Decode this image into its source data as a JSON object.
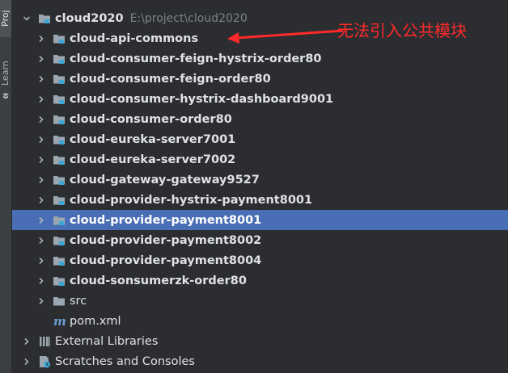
{
  "tool_strip": {
    "project_tab": "Proj",
    "learn_tab": "Learn"
  },
  "root": {
    "name": "cloud2020",
    "path": "E:\\project\\cloud2020"
  },
  "modules": [
    {
      "label": "cloud-api-commons"
    },
    {
      "label": "cloud-consumer-feign-hystrix-order80"
    },
    {
      "label": "cloud-consumer-feign-order80"
    },
    {
      "label": "cloud-consumer-hystrix-dashboard9001"
    },
    {
      "label": "cloud-consumer-order80"
    },
    {
      "label": "cloud-eureka-server7001"
    },
    {
      "label": "cloud-eureka-server7002"
    },
    {
      "label": "cloud-gateway-gateway9527"
    },
    {
      "label": "cloud-provider-hystrix-payment8001"
    },
    {
      "label": "cloud-provider-payment8001",
      "selected": true
    },
    {
      "label": "cloud-provider-payment8002"
    },
    {
      "label": "cloud-provider-payment8004"
    },
    {
      "label": "cloud-sonsumerzk-order80"
    }
  ],
  "src_folder": "src",
  "pom_file": "pom.xml",
  "external_libraries": "External Libraries",
  "scratches": "Scratches and Consoles",
  "annotation": {
    "text": "无法引入公共模块",
    "color": "#ff2a2a"
  },
  "colors": {
    "background": "#2b2d30",
    "selection": "#4a6eb5",
    "text": "#dfe1e5",
    "module_badge": "#3fa7d6"
  }
}
